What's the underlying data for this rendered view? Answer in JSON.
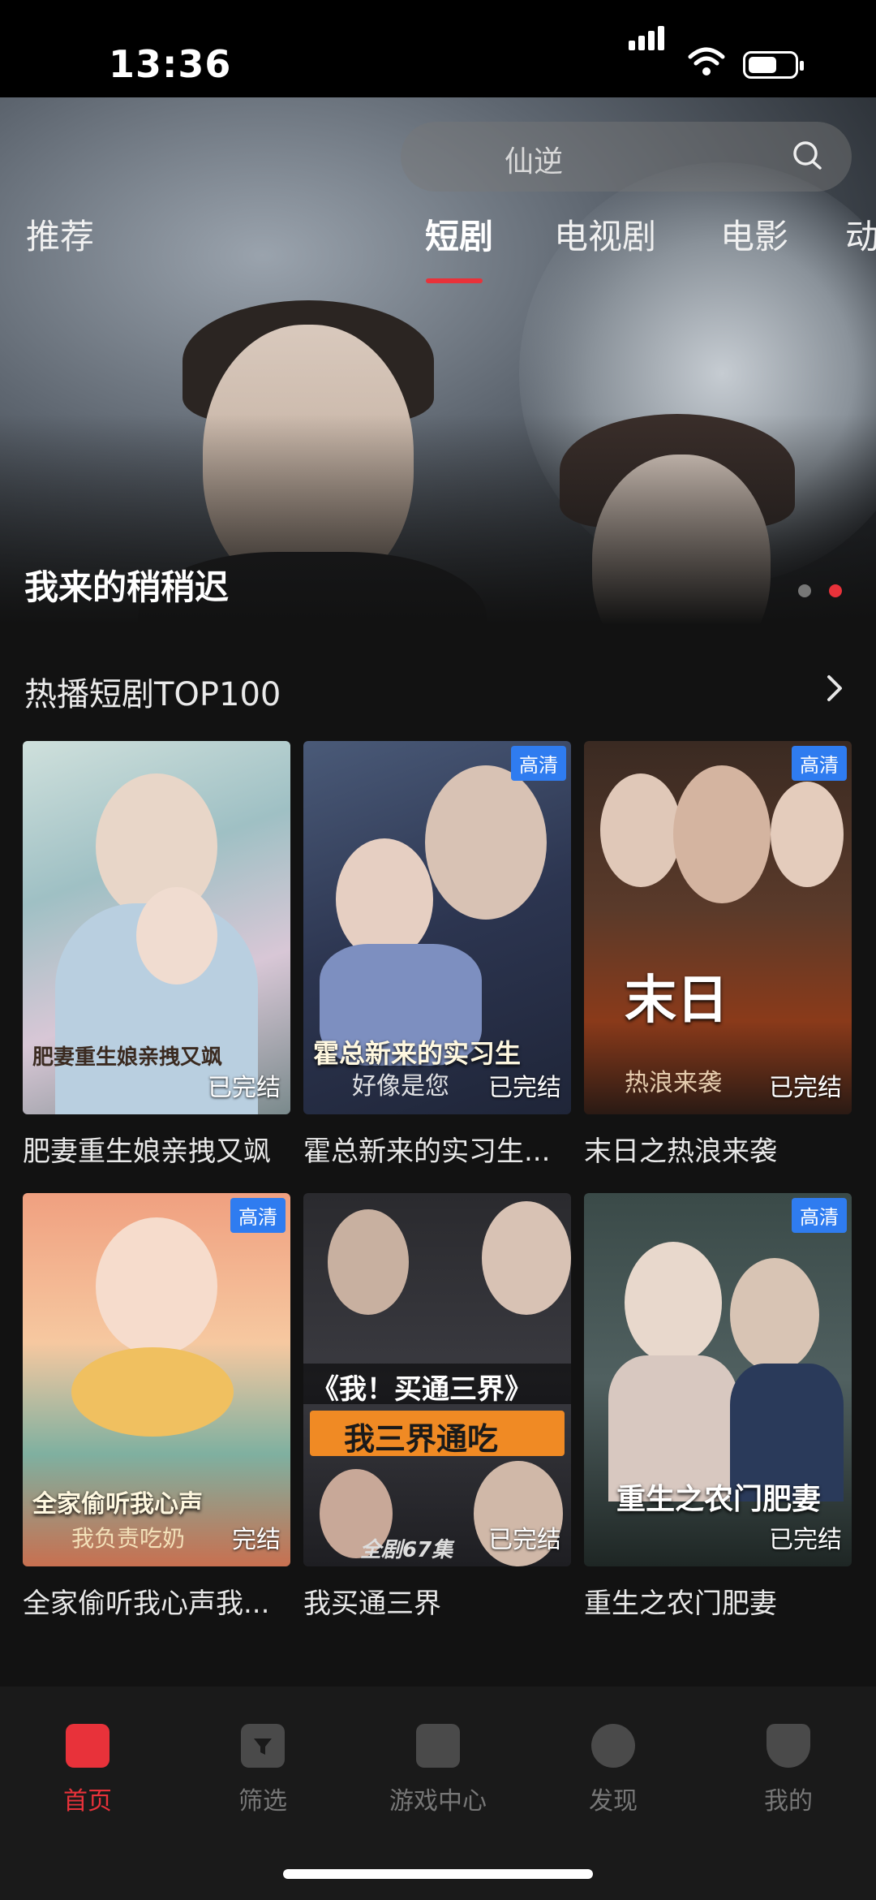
{
  "status": {
    "time": "13:36"
  },
  "search": {
    "placeholder": "仙逆"
  },
  "tabs": [
    {
      "label": "推荐"
    },
    {
      "label": "短剧"
    },
    {
      "label": "电视剧"
    },
    {
      "label": "电影"
    },
    {
      "label": "动"
    }
  ],
  "hero": {
    "title": "我来的稍稍迟"
  },
  "section": {
    "title": "热播短剧TOP100"
  },
  "cards": [
    {
      "label": "肥妻重生娘亲拽又飒",
      "badge": "",
      "status": "已完结",
      "poster_text": "肥妻重生娘亲拽又飒",
      "poster_sub": ""
    },
    {
      "label": "霍总新来的实习生...",
      "badge": "高清",
      "status": "已完结",
      "poster_text": "霍总新来的实习生",
      "poster_sub": "好像是您"
    },
    {
      "label": "末日之热浪来袭",
      "badge": "高清",
      "status": "已完结",
      "poster_text": "末日",
      "poster_sub": "热浪来袭"
    },
    {
      "label": "全家偷听我心声我...",
      "badge": "高清",
      "status": "",
      "poster_text": "全家偷听我心声",
      "poster_sub": "我负责吃奶"
    },
    {
      "label": "我买通三界",
      "badge": "",
      "status": "已完结",
      "poster_text": "《我！买通三界》",
      "poster_sub": "我三界通吃"
    },
    {
      "label": "重生之农门肥妻",
      "badge": "高清",
      "status": "已完结",
      "poster_text": "重生之农门肥妻",
      "poster_sub": ""
    }
  ],
  "card4_status": "完结",
  "card5_extra": "全剧67集",
  "nav": [
    {
      "label": "首页"
    },
    {
      "label": "筛选"
    },
    {
      "label": "游戏中心"
    },
    {
      "label": "发现"
    },
    {
      "label": "我的"
    }
  ],
  "colors": {
    "accent": "#e8323a",
    "badge": "#2f7cf0",
    "background": "#121212"
  }
}
